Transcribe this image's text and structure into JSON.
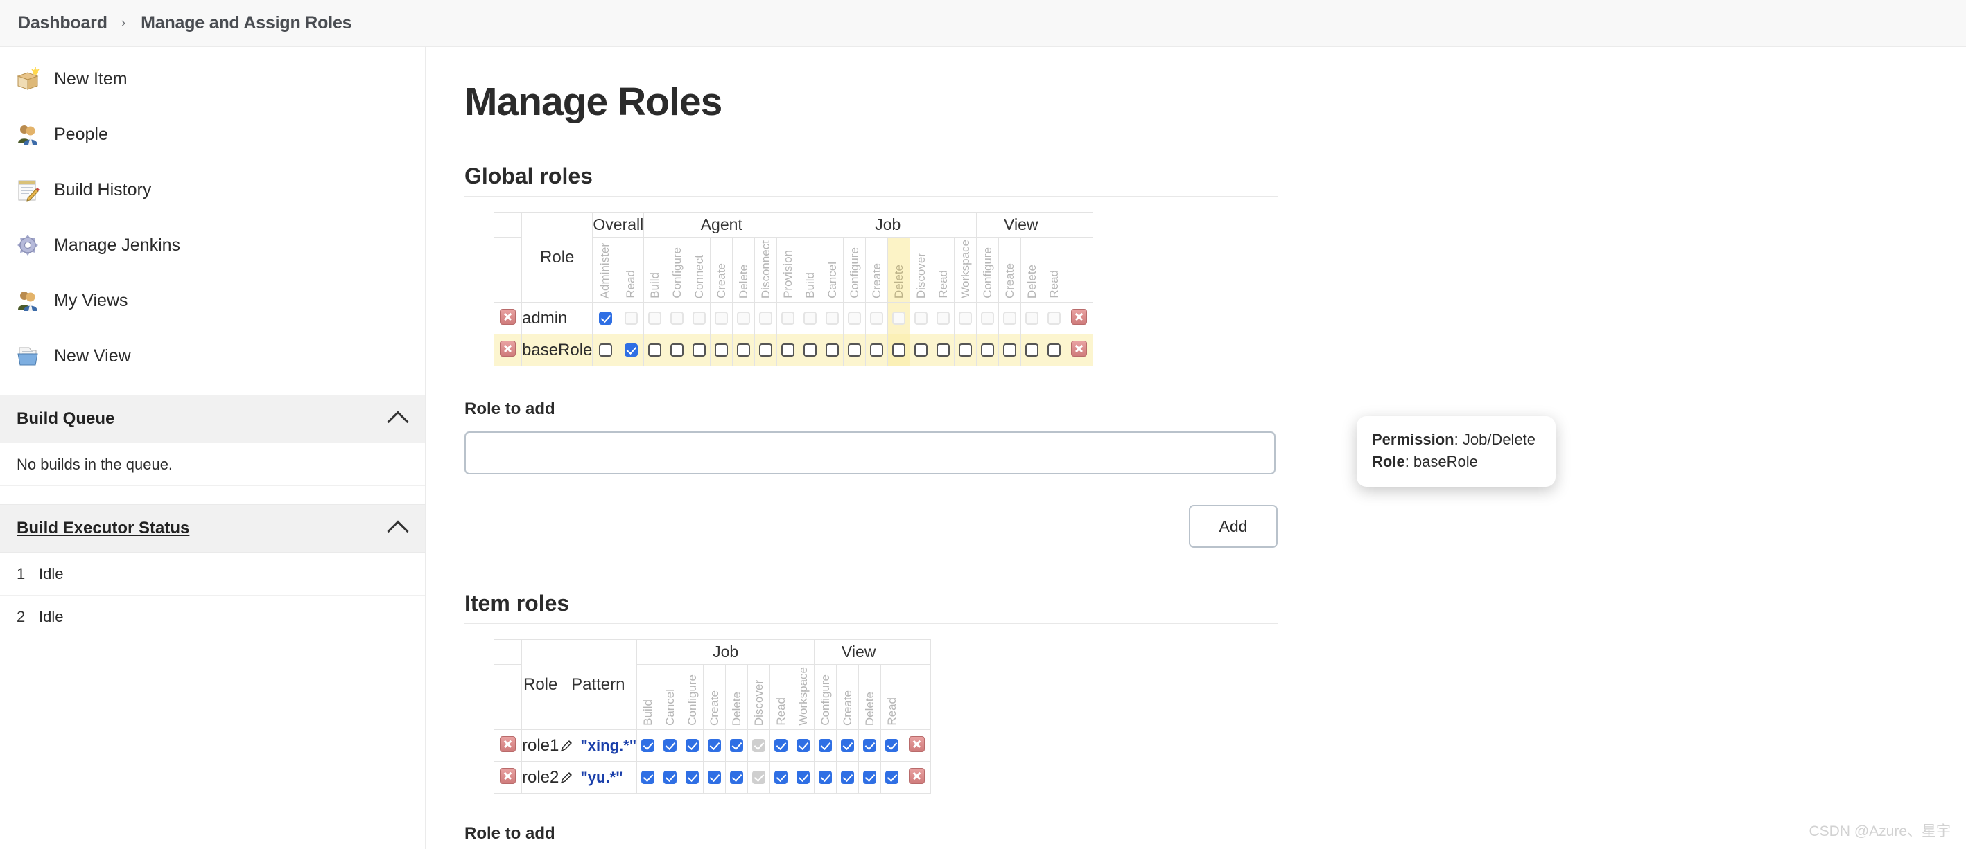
{
  "breadcrumb": {
    "root": "Dashboard",
    "separator": "›",
    "current": "Manage and Assign Roles"
  },
  "sidebar": {
    "items": [
      {
        "label": "New Item",
        "icon": "new-item-icon"
      },
      {
        "label": "People",
        "icon": "people-icon"
      },
      {
        "label": "Build History",
        "icon": "build-history-icon"
      },
      {
        "label": "Manage Jenkins",
        "icon": "gear-icon"
      },
      {
        "label": "My Views",
        "icon": "my-views-icon"
      },
      {
        "label": "New View",
        "icon": "new-view-icon"
      }
    ],
    "build_queue": {
      "title": "Build Queue",
      "empty_text": "No builds in the queue."
    },
    "build_executor_status": {
      "title": "Build Executor Status",
      "executors": [
        {
          "num": "1",
          "status": "Idle"
        },
        {
          "num": "2",
          "status": "Idle"
        }
      ]
    }
  },
  "main": {
    "page_title": "Manage Roles",
    "global_roles": {
      "heading": "Global roles",
      "role_col": "Role",
      "groups": [
        {
          "label": "Overall",
          "span": 2
        },
        {
          "label": "Agent",
          "span": 7
        },
        {
          "label": "Job",
          "span": 8
        },
        {
          "label": "View",
          "span": 4
        }
      ],
      "columns": [
        "Administer",
        "Read",
        "Build",
        "Configure",
        "Connect",
        "Create",
        "Delete",
        "Disconnect",
        "Provision",
        "Build",
        "Cancel",
        "Configure",
        "Create",
        "Delete",
        "Discover",
        "Read",
        "Workspace",
        "Configure",
        "Create",
        "Delete",
        "Read"
      ],
      "highlight_column_index": 13,
      "rows": [
        {
          "name": "admin",
          "highlighted": false,
          "checks": [
            "on",
            "off-dis",
            "off-dis",
            "off-dis",
            "off-dis",
            "off-dis",
            "off-dis",
            "off-dis",
            "off-dis",
            "off-dis",
            "off-dis",
            "off-dis",
            "off-dis",
            "off-dis",
            "off-dis",
            "off-dis",
            "off-dis",
            "off-dis",
            "off-dis",
            "off-dis",
            "off-dis"
          ]
        },
        {
          "name": "baseRole",
          "highlighted": true,
          "checks": [
            "off",
            "on",
            "off",
            "off",
            "off",
            "off",
            "off",
            "off",
            "off",
            "off",
            "off",
            "off",
            "off",
            "off",
            "off",
            "off",
            "off",
            "off",
            "off",
            "off",
            "off"
          ]
        }
      ]
    },
    "role_to_add_1": {
      "label": "Role to add",
      "value": "",
      "placeholder": ""
    },
    "add_button_1": "Add",
    "tooltip": {
      "permission_label": "Permission",
      "permission_value": "Job/Delete",
      "role_label": "Role",
      "role_value": "baseRole"
    },
    "item_roles": {
      "heading": "Item roles",
      "role_col": "Role",
      "pattern_col": "Pattern",
      "groups": [
        {
          "label": "Job",
          "span": 8
        },
        {
          "label": "View",
          "span": 4
        }
      ],
      "columns": [
        "Build",
        "Cancel",
        "Configure",
        "Create",
        "Delete",
        "Discover",
        "Read",
        "Workspace",
        "Configure",
        "Create",
        "Delete",
        "Read"
      ],
      "rows": [
        {
          "name": "role1",
          "pattern": "\"xing.*\"",
          "checks": [
            "on",
            "on",
            "on",
            "on",
            "on",
            "on-dis",
            "on",
            "on",
            "on",
            "on",
            "on",
            "on"
          ]
        },
        {
          "name": "role2",
          "pattern": "\"yu.*\"",
          "checks": [
            "on",
            "on",
            "on",
            "on",
            "on",
            "on-dis",
            "on",
            "on",
            "on",
            "on",
            "on",
            "on"
          ]
        }
      ]
    },
    "role_to_add_2": {
      "label": "Role to add"
    }
  },
  "watermark": "CSDN @Azure、星宇",
  "colors": {
    "accent_blue": "#2f6fe4",
    "highlight_yellow": "#fcf3c6",
    "row_highlight": "#fcf5cf",
    "delete_red": "#cf7b7b",
    "pattern_blue": "#1a3faa"
  }
}
